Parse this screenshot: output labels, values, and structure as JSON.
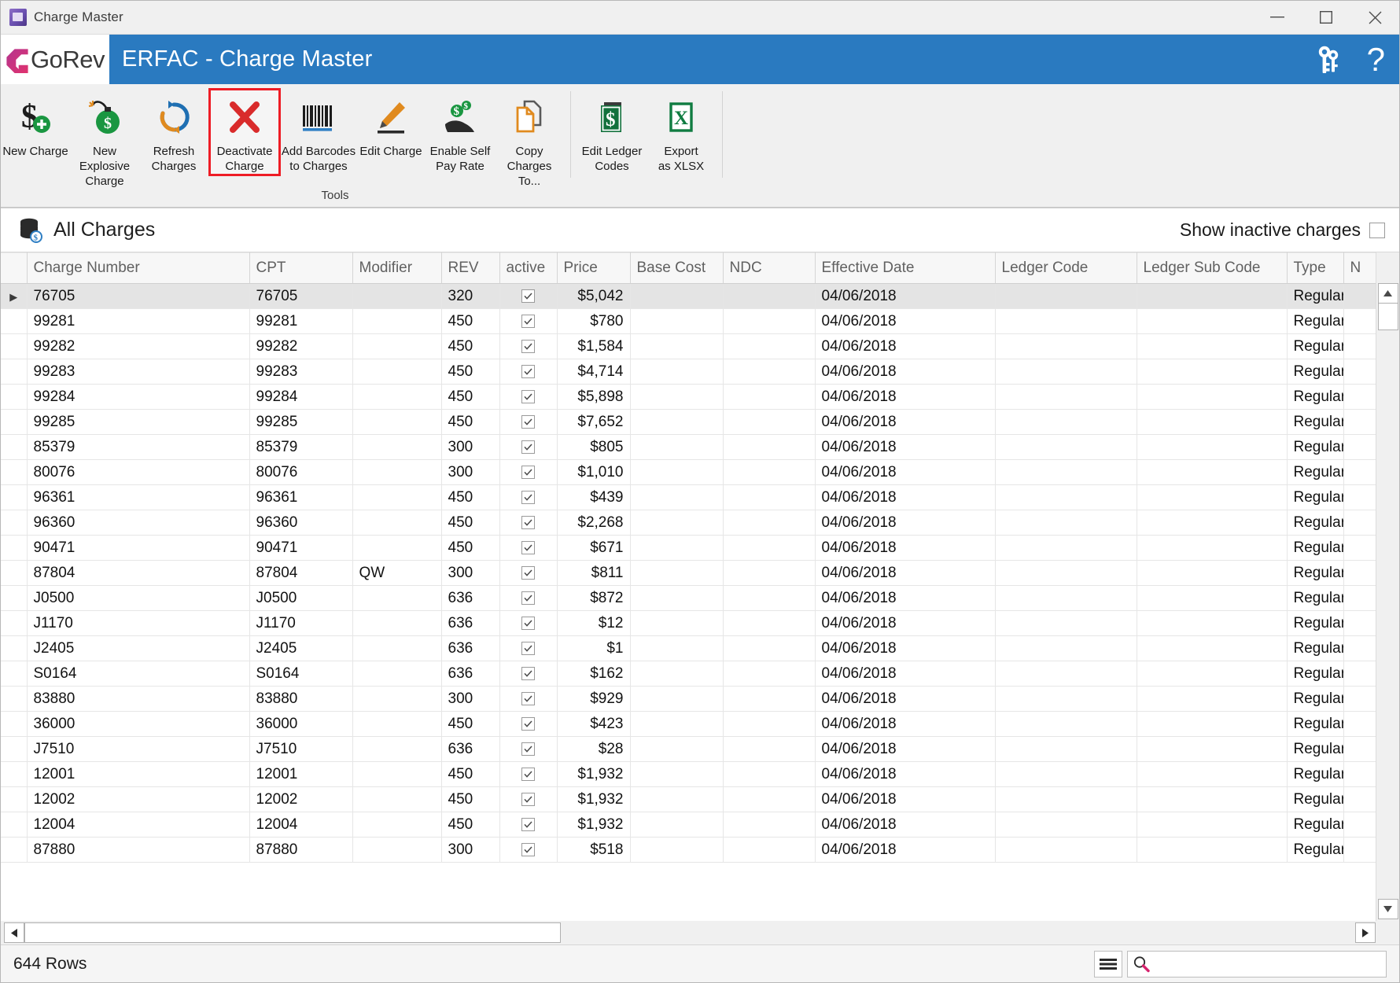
{
  "window": {
    "title": "Charge Master",
    "app_icon": "app-icon",
    "controls": {
      "minimize": "minimize-icon",
      "maximize": "maximize-icon",
      "close": "close-icon"
    }
  },
  "brand": {
    "logo_text": "GoRev",
    "title": "ERFAC - Charge Master",
    "keys_icon": "keys-icon",
    "help_icon": "question-mark-icon",
    "header_bg": "#2a7ac0"
  },
  "ribbon": {
    "group_caption": "Tools",
    "selection_highlight": "#ee1c25",
    "items": [
      {
        "label": "New Charge",
        "icon": "dollar-plus-icon",
        "selected": false
      },
      {
        "label": "New Explosive\nCharge",
        "icon": "bomb-dollar-icon",
        "selected": false
      },
      {
        "label": "Refresh\nCharges",
        "icon": "refresh-icon",
        "selected": false
      },
      {
        "label": "Deactivate\nCharge",
        "icon": "red-x-icon",
        "selected": true
      },
      {
        "label": "Add Barcodes\nto Charges",
        "icon": "barcode-icon",
        "selected": false
      },
      {
        "label": "Edit Charge",
        "icon": "pencil-icon",
        "selected": false
      },
      {
        "label": "Enable Self\nPay Rate",
        "icon": "money-hand-icon",
        "selected": false
      },
      {
        "label": "Copy Charges\nTo...",
        "icon": "copy-document-icon",
        "selected": false
      }
    ],
    "items2": [
      {
        "label": "Edit Ledger\nCodes",
        "icon": "ledger-book-icon",
        "selected": false
      },
      {
        "label": "Export\nas XLSX",
        "icon": "excel-icon",
        "selected": false
      }
    ]
  },
  "panel": {
    "icon": "database-dollar-icon",
    "title": "All Charges",
    "show_inactive_label": "Show inactive charges",
    "show_inactive_checked": false
  },
  "grid": {
    "columns": [
      "Charge Number",
      "CPT",
      "Modifier",
      "REV",
      "active",
      "Price",
      "Base Cost",
      "NDC",
      "Effective Date",
      "Ledger Code",
      "Ledger Sub Code",
      "Type",
      "N"
    ],
    "rows": [
      {
        "charge_number": "76705",
        "cpt": "76705",
        "modifier": "",
        "rev": "320",
        "active": true,
        "price": "$5,042",
        "base_cost": "",
        "ndc": "",
        "effective_date": "04/06/2018",
        "ledger_code": "",
        "ledger_sub_code": "",
        "type": "Regular",
        "selected": true
      },
      {
        "charge_number": "99281",
        "cpt": "99281",
        "modifier": "",
        "rev": "450",
        "active": true,
        "price": "$780",
        "base_cost": "",
        "ndc": "",
        "effective_date": "04/06/2018",
        "ledger_code": "",
        "ledger_sub_code": "",
        "type": "Regular",
        "selected": false
      },
      {
        "charge_number": "99282",
        "cpt": "99282",
        "modifier": "",
        "rev": "450",
        "active": true,
        "price": "$1,584",
        "base_cost": "",
        "ndc": "",
        "effective_date": "04/06/2018",
        "ledger_code": "",
        "ledger_sub_code": "",
        "type": "Regular",
        "selected": false
      },
      {
        "charge_number": "99283",
        "cpt": "99283",
        "modifier": "",
        "rev": "450",
        "active": true,
        "price": "$4,714",
        "base_cost": "",
        "ndc": "",
        "effective_date": "04/06/2018",
        "ledger_code": "",
        "ledger_sub_code": "",
        "type": "Regular",
        "selected": false
      },
      {
        "charge_number": "99284",
        "cpt": "99284",
        "modifier": "",
        "rev": "450",
        "active": true,
        "price": "$5,898",
        "base_cost": "",
        "ndc": "",
        "effective_date": "04/06/2018",
        "ledger_code": "",
        "ledger_sub_code": "",
        "type": "Regular",
        "selected": false
      },
      {
        "charge_number": "99285",
        "cpt": "99285",
        "modifier": "",
        "rev": "450",
        "active": true,
        "price": "$7,652",
        "base_cost": "",
        "ndc": "",
        "effective_date": "04/06/2018",
        "ledger_code": "",
        "ledger_sub_code": "",
        "type": "Regular",
        "selected": false
      },
      {
        "charge_number": "85379",
        "cpt": "85379",
        "modifier": "",
        "rev": "300",
        "active": true,
        "price": "$805",
        "base_cost": "",
        "ndc": "",
        "effective_date": "04/06/2018",
        "ledger_code": "",
        "ledger_sub_code": "",
        "type": "Regular",
        "selected": false
      },
      {
        "charge_number": "80076",
        "cpt": "80076",
        "modifier": "",
        "rev": "300",
        "active": true,
        "price": "$1,010",
        "base_cost": "",
        "ndc": "",
        "effective_date": "04/06/2018",
        "ledger_code": "",
        "ledger_sub_code": "",
        "type": "Regular",
        "selected": false
      },
      {
        "charge_number": "96361",
        "cpt": "96361",
        "modifier": "",
        "rev": "450",
        "active": true,
        "price": "$439",
        "base_cost": "",
        "ndc": "",
        "effective_date": "04/06/2018",
        "ledger_code": "",
        "ledger_sub_code": "",
        "type": "Regular",
        "selected": false
      },
      {
        "charge_number": "96360",
        "cpt": "96360",
        "modifier": "",
        "rev": "450",
        "active": true,
        "price": "$2,268",
        "base_cost": "",
        "ndc": "",
        "effective_date": "04/06/2018",
        "ledger_code": "",
        "ledger_sub_code": "",
        "type": "Regular",
        "selected": false
      },
      {
        "charge_number": "90471",
        "cpt": "90471",
        "modifier": "",
        "rev": "450",
        "active": true,
        "price": "$671",
        "base_cost": "",
        "ndc": "",
        "effective_date": "04/06/2018",
        "ledger_code": "",
        "ledger_sub_code": "",
        "type": "Regular",
        "selected": false
      },
      {
        "charge_number": "87804",
        "cpt": "87804",
        "modifier": "QW",
        "rev": "300",
        "active": true,
        "price": "$811",
        "base_cost": "",
        "ndc": "",
        "effective_date": "04/06/2018",
        "ledger_code": "",
        "ledger_sub_code": "",
        "type": "Regular",
        "selected": false
      },
      {
        "charge_number": "J0500",
        "cpt": "J0500",
        "modifier": "",
        "rev": "636",
        "active": true,
        "price": "$872",
        "base_cost": "",
        "ndc": "",
        "effective_date": "04/06/2018",
        "ledger_code": "",
        "ledger_sub_code": "",
        "type": "Regular",
        "selected": false
      },
      {
        "charge_number": "J1170",
        "cpt": "J1170",
        "modifier": "",
        "rev": "636",
        "active": true,
        "price": "$12",
        "base_cost": "",
        "ndc": "",
        "effective_date": "04/06/2018",
        "ledger_code": "",
        "ledger_sub_code": "",
        "type": "Regular",
        "selected": false
      },
      {
        "charge_number": "J2405",
        "cpt": "J2405",
        "modifier": "",
        "rev": "636",
        "active": true,
        "price": "$1",
        "base_cost": "",
        "ndc": "",
        "effective_date": "04/06/2018",
        "ledger_code": "",
        "ledger_sub_code": "",
        "type": "Regular",
        "selected": false
      },
      {
        "charge_number": "S0164",
        "cpt": "S0164",
        "modifier": "",
        "rev": "636",
        "active": true,
        "price": "$162",
        "base_cost": "",
        "ndc": "",
        "effective_date": "04/06/2018",
        "ledger_code": "",
        "ledger_sub_code": "",
        "type": "Regular",
        "selected": false
      },
      {
        "charge_number": "83880",
        "cpt": "83880",
        "modifier": "",
        "rev": "300",
        "active": true,
        "price": "$929",
        "base_cost": "",
        "ndc": "",
        "effective_date": "04/06/2018",
        "ledger_code": "",
        "ledger_sub_code": "",
        "type": "Regular",
        "selected": false
      },
      {
        "charge_number": "36000",
        "cpt": "36000",
        "modifier": "",
        "rev": "450",
        "active": true,
        "price": "$423",
        "base_cost": "",
        "ndc": "",
        "effective_date": "04/06/2018",
        "ledger_code": "",
        "ledger_sub_code": "",
        "type": "Regular",
        "selected": false
      },
      {
        "charge_number": "J7510",
        "cpt": "J7510",
        "modifier": "",
        "rev": "636",
        "active": true,
        "price": "$28",
        "base_cost": "",
        "ndc": "",
        "effective_date": "04/06/2018",
        "ledger_code": "",
        "ledger_sub_code": "",
        "type": "Regular",
        "selected": false
      },
      {
        "charge_number": "12001",
        "cpt": "12001",
        "modifier": "",
        "rev": "450",
        "active": true,
        "price": "$1,932",
        "base_cost": "",
        "ndc": "",
        "effective_date": "04/06/2018",
        "ledger_code": "",
        "ledger_sub_code": "",
        "type": "Regular",
        "selected": false
      },
      {
        "charge_number": "12002",
        "cpt": "12002",
        "modifier": "",
        "rev": "450",
        "active": true,
        "price": "$1,932",
        "base_cost": "",
        "ndc": "",
        "effective_date": "04/06/2018",
        "ledger_code": "",
        "ledger_sub_code": "",
        "type": "Regular",
        "selected": false
      },
      {
        "charge_number": "12004",
        "cpt": "12004",
        "modifier": "",
        "rev": "450",
        "active": true,
        "price": "$1,932",
        "base_cost": "",
        "ndc": "",
        "effective_date": "04/06/2018",
        "ledger_code": "",
        "ledger_sub_code": "",
        "type": "Regular",
        "selected": false
      },
      {
        "charge_number": "87880",
        "cpt": "87880",
        "modifier": "",
        "rev": "300",
        "active": true,
        "price": "$518",
        "base_cost": "",
        "ndc": "",
        "effective_date": "04/06/2018",
        "ledger_code": "",
        "ledger_sub_code": "",
        "type": "Regular",
        "selected": false
      }
    ]
  },
  "status": {
    "row_count": "644 Rows",
    "menu_icon": "hamburger-menu-icon",
    "search_icon": "search-icon",
    "search_value": "",
    "search_placeholder": ""
  }
}
